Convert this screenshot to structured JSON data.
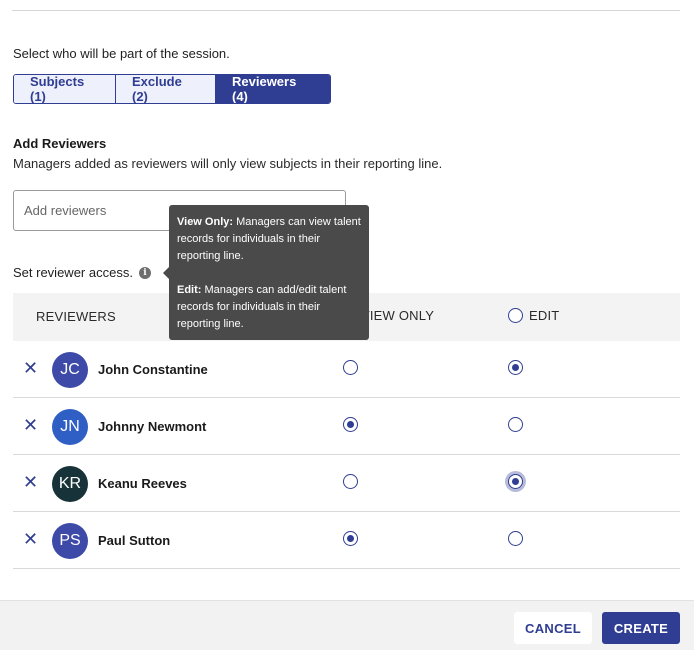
{
  "session": {
    "select_label": "Select who will be part of the session.",
    "tabs": [
      {
        "label": "Subjects (1)",
        "active": false
      },
      {
        "label": "Exclude (2)",
        "active": false
      },
      {
        "label": "Reviewers (4)",
        "active": true
      }
    ]
  },
  "add_reviewers": {
    "title": "Add Reviewers",
    "description": "Managers added as reviewers will only view subjects in their reporting line.",
    "placeholder": "Add reviewers"
  },
  "access": {
    "label": "Set reviewer access.",
    "info_icon": "info-icon"
  },
  "tooltip": {
    "view_title": "View Only:",
    "view_text": " Managers can view talent records for individuals in their reporting line.",
    "edit_title": "Edit:",
    "edit_text": " Managers can add/edit talent records for individuals in their reporting line."
  },
  "table": {
    "headers": {
      "reviewers": "REVIEWERS",
      "view_only": "VIEW ONLY",
      "edit": "EDIT"
    },
    "rows": [
      {
        "initials": "JC",
        "name": "John Constantine",
        "access": "edit",
        "avatar_color": "#3d4aa8"
      },
      {
        "initials": "JN",
        "name": "Johnny Newmont",
        "access": "view",
        "avatar_color": "#2f5fc4"
      },
      {
        "initials": "KR",
        "name": "Keanu Reeves",
        "access": "edit",
        "avatar_color": "#173238"
      },
      {
        "initials": "PS",
        "name": "Paul Sutton",
        "access": "view",
        "avatar_color": "#3d4aa8"
      }
    ]
  },
  "footer": {
    "cancel_label": "CANCEL",
    "create_label": "CREATE"
  },
  "colors": {
    "primary": "#2f3d93",
    "tooltip_bg": "#4a4a4a"
  }
}
